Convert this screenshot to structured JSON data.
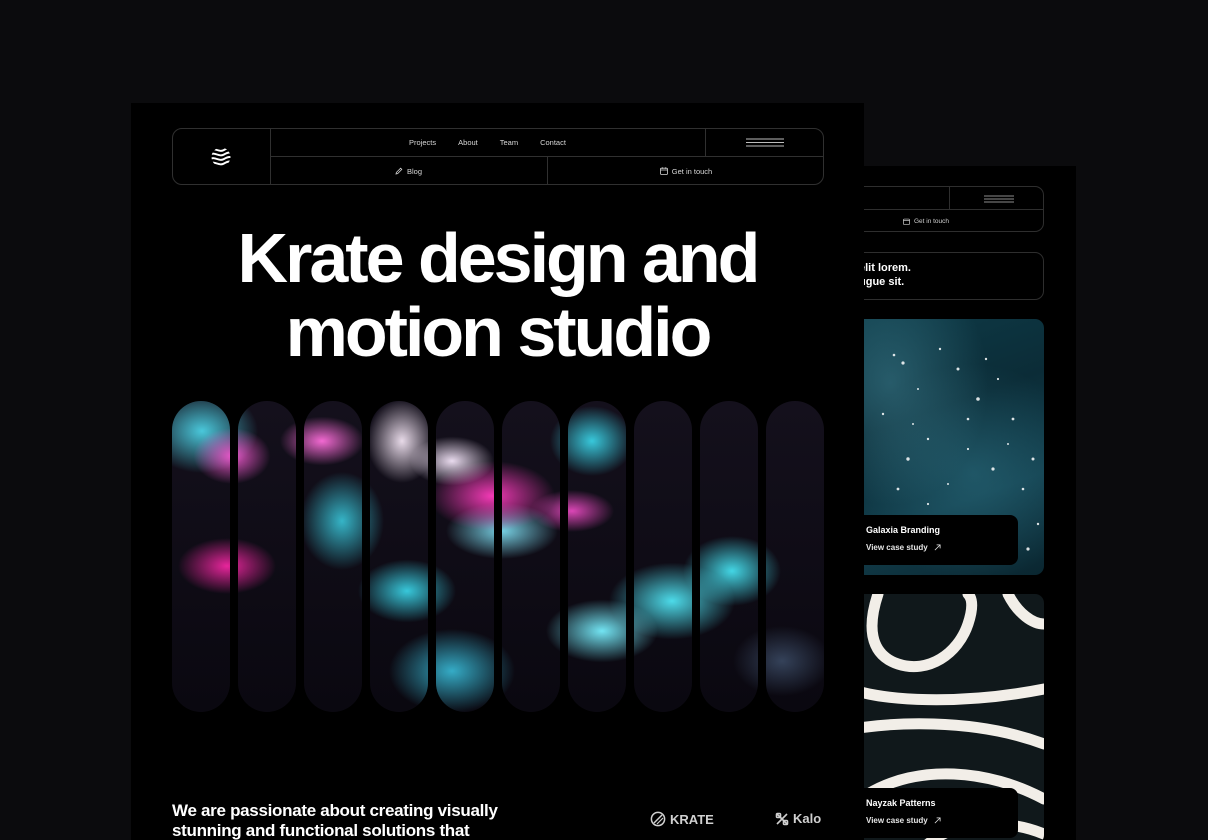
{
  "nav": {
    "links": [
      "Projects",
      "About",
      "Team",
      "Contact"
    ],
    "blog_label": "Blog",
    "get_in_touch_label": "Get in touch"
  },
  "hero": {
    "line1": "Krate design and",
    "line2": "motion studio"
  },
  "tagline": {
    "line1": "We are passionate about creating visually",
    "line2": "stunning and functional solutions that"
  },
  "brands": [
    "KRATE",
    "Kalo"
  ],
  "second_page": {
    "nav": {
      "get_in_touch_label": "Get in touch"
    },
    "hero": {
      "line1": "elit lorem.",
      "line2": "ugue sit."
    },
    "cards": [
      {
        "title": "Galaxia Branding",
        "link": "View case study"
      },
      {
        "title": "Nayzak Patterns",
        "link": "View case study"
      }
    ]
  },
  "icons": [
    "wave-logo-icon",
    "hamburger-icon",
    "pencil-icon",
    "calendar-icon",
    "arrow-up-right-icon",
    "krate-logo-icon",
    "kalo-logo-icon"
  ],
  "colors": {
    "background": "#0b0b0d",
    "page": "#000000",
    "border": "#303030",
    "accent_cyan": "#3ad8ee",
    "accent_pink": "#ff3cbe"
  }
}
